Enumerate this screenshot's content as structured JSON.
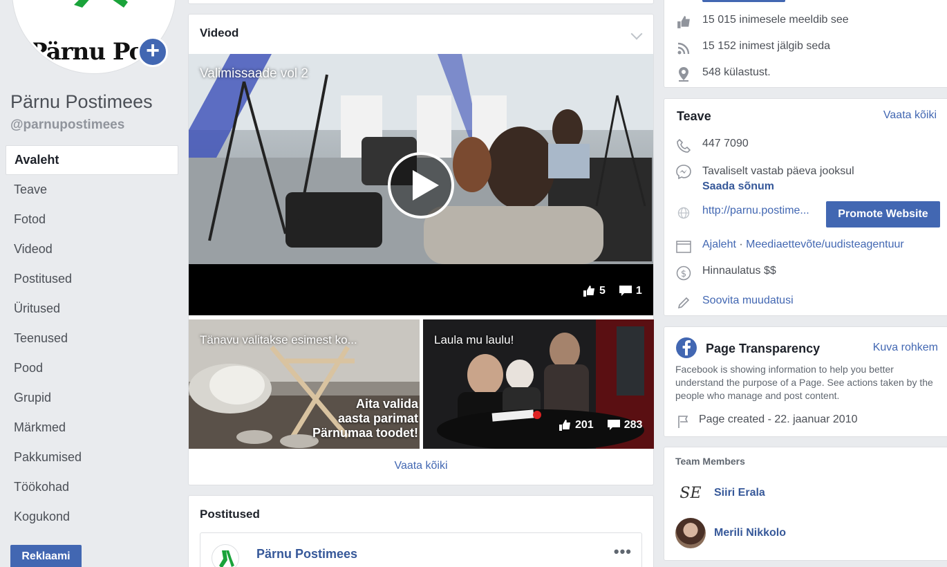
{
  "left": {
    "logo_text": "Pärnu Postimees",
    "page_name": "Pärnu Postimees",
    "page_handle": "@parnupostimees",
    "nav": [
      "Avaleht",
      "Teave",
      "Fotod",
      "Videod",
      "Postitused",
      "Üritused",
      "Teenused",
      "Pood",
      "Grupid",
      "Märkmed",
      "Pakkumised",
      "Töökohad",
      "Kogukond"
    ],
    "ad_button": "Reklaami"
  },
  "videos": {
    "title": "Videod",
    "main": {
      "title": "Valimissaade vol 2",
      "likes": "5",
      "comments": "1"
    },
    "thumb1": {
      "title": "Tänavu valitakse esimest ko...",
      "promo_line1": "Aita valida",
      "promo_line2": "aasta parimat",
      "promo_line3": "Pärnumaa toodet!"
    },
    "thumb2": {
      "title": "Laula mu laulu!",
      "likes": "201",
      "comments": "283"
    },
    "see_all": "Vaata kõiki"
  },
  "posts": {
    "title": "Postitused",
    "author": "Pärnu Postimees",
    "more": "•••"
  },
  "right": {
    "likes_text": "15 015 inimesele meeldib see",
    "follows_text": "15 152 inimest jälgib seda",
    "visits_text": "548 külastust.",
    "info": {
      "title": "Teave",
      "see_all": "Vaata kõiki",
      "phone": "447 7090",
      "response": "Tavaliselt vastab päeva jooksul",
      "send_message": "Saada sõnum",
      "website": "http://parnu.postime...",
      "promote": "Promote Website",
      "category_a": "Ajaleht",
      "category_sep": " · ",
      "category_b": "Meediaettevõte/uudisteagentuur",
      "price": "Hinnaulatus $$",
      "suggest": "Soovita muudatusi"
    },
    "transparency": {
      "title": "Page Transparency",
      "see_more": "Kuva rohkem",
      "text": "Facebook is showing information to help you better understand the purpose of a Page. See actions taken by the people who manage and post content.",
      "created": "Page created - 22. jaanuar 2010"
    },
    "team": {
      "title": "Team Members",
      "members": [
        {
          "name": "Siiri Erala",
          "initials": "SE"
        },
        {
          "name": "Merili Nikkolo"
        }
      ]
    }
  },
  "colors": {
    "fb_blue": "#4267b2",
    "link_dark": "#365899",
    "bg": "#e9ebee"
  }
}
